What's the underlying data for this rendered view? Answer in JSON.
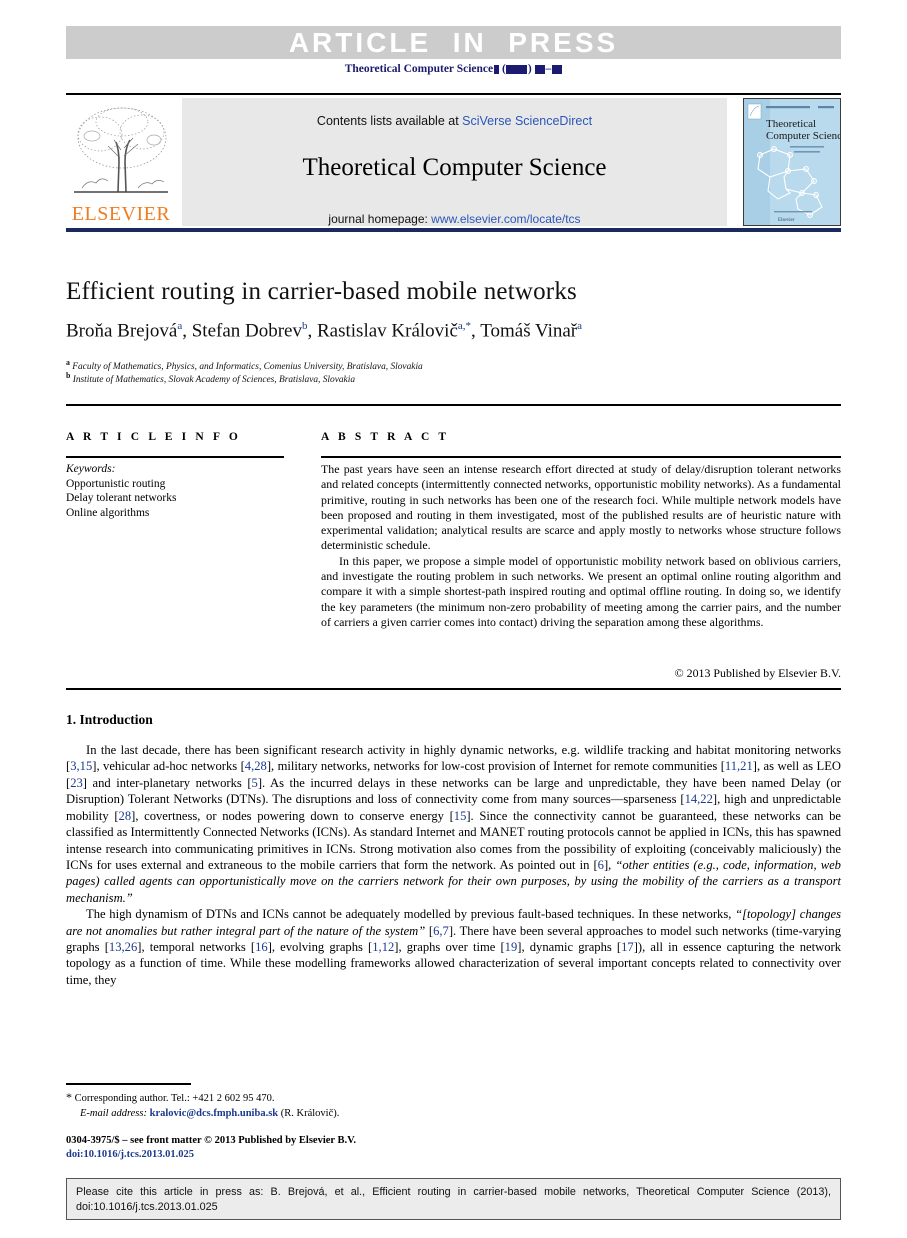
{
  "banner": {
    "label": "ARTICLE  IN  PRESS",
    "background_color": "#cccccc",
    "text_color": "#ffffff"
  },
  "journal_running_head": {
    "name": "Theoretical Computer Science",
    "volume_placeholder": "■",
    "year_placeholder": "(■■■■)",
    "pages_placeholder": "■■■–■■■",
    "color": "#1b1b6f"
  },
  "masthead": {
    "publisher_name": "ELSEVIER",
    "publisher_color": "#ef7d22",
    "publisher_logo_icon": "elsevier-tree-icon",
    "contents_prefix": "Contents lists available at",
    "contents_link": "SciVerse ScienceDirect",
    "journal_title": "Theoretical Computer Science",
    "homepage_prefix": "journal homepage:",
    "homepage_link": "www.elsevier.com/locate/tcs",
    "link_color": "#2a56b8",
    "cover_title_line1": "Theoretical",
    "cover_title_line2": "Computer Science",
    "cover_subtitle": "",
    "cover_background_color": "#b9d9ec"
  },
  "article": {
    "title": "Efficient routing in carrier-based mobile networks",
    "authors": [
      {
        "name": "Broňa Brejová",
        "marks": "a"
      },
      {
        "name": "Stefan Dobrev",
        "marks": "b"
      },
      {
        "name": "Rastislav Královič",
        "marks": "a,*"
      },
      {
        "name": "Tomáš Vinař",
        "marks": "a"
      }
    ],
    "affiliations": [
      {
        "mark": "a",
        "text": "Faculty of Mathematics, Physics, and Informatics, Comenius University, Bratislava, Slovakia"
      },
      {
        "mark": "b",
        "text": "Institute of Mathematics, Slovak Academy of Sciences, Bratislava, Slovakia"
      }
    ]
  },
  "article_info": {
    "heading": "A R T I C L E  I N F O",
    "keywords_label": "Keywords:",
    "keywords": [
      "Opportunistic routing",
      "Delay tolerant networks",
      "Online algorithms"
    ]
  },
  "abstract": {
    "heading": "A B S T R A C T",
    "paragraph_1": "The past years have seen an intense research effort directed at study of delay/disruption tolerant networks and related concepts (intermittently connected networks, opportunistic mobility networks). As a fundamental primitive, routing in such networks has been one of the research foci. While multiple network models have been proposed and routing in them investigated, most of the published results are of heuristic nature with experimental validation; analytical results are scarce and apply mostly to networks whose structure follows deterministic schedule.",
    "paragraph_2": "In this paper, we propose a simple model of opportunistic mobility network based on oblivious carriers, and investigate the routing problem in such networks. We present an optimal online routing algorithm and compare it with a simple shortest-path inspired routing and optimal offline routing. In doing so, we identify the key parameters (the minimum non-zero probability of meeting among the carrier pairs, and the number of carriers a given carrier comes into contact) driving the separation among these algorithms.",
    "copyright": "© 2013 Published by Elsevier B.V."
  },
  "sections": {
    "intro_heading": "1. Introduction",
    "intro_p1_parts": {
      "t1": "In the last decade, there has been significant research activity in highly dynamic networks, e.g. wildlife tracking and habitat monitoring networks [",
      "c1": "3,15",
      "t2": "], vehicular ad-hoc networks [",
      "c2": "4,28",
      "t3": "], military networks, networks for low-cost provision of Internet for remote communities [",
      "c3": "11,21",
      "t4": "], as well as LEO [",
      "c4": "23",
      "t5": "] and inter-planetary networks [",
      "c5": "5",
      "t6": "]. As the incurred delays in these networks can be large and unpredictable, they have been named Delay (or Disruption) Tolerant Networks (DTNs). The disruptions and loss of connectivity come from many sources—sparseness [",
      "c6": "14,22",
      "t7": "], high and unpredictable mobility [",
      "c7": "28",
      "t8": "], covertness, or nodes powering down to conserve energy [",
      "c8": "15",
      "t9": "]. Since the connectivity cannot be guaranteed, these networks can be classified as Intermittently Connected Networks (ICNs). As standard Internet and MANET routing protocols cannot be applied in ICNs, this has spawned intense research into communicating primitives in ICNs. Strong motivation also comes from the possibility of exploiting (conceivably maliciously) the ICNs for uses external and extraneous to the mobile carriers that form the network. As pointed out in [",
      "c9": "6",
      "t10": "], ",
      "quote": "“other entities (e.g., code, information, web pages) called agents can opportunistically move on the carriers network for their own purposes, by using the mobility of the carriers as a transport mechanism.”"
    },
    "intro_p2_parts": {
      "t1": "The high dynamism of DTNs and ICNs cannot be adequately modelled by previous fault-based techniques. In these networks, ",
      "quote": "“[topology] changes are not anomalies but rather integral part of the nature of the system”",
      "t2": " [",
      "c1": "6,7",
      "t3": "]. There have been several approaches to model such networks (time-varying graphs [",
      "c2": "13,26",
      "t4": "], temporal networks [",
      "c3": "16",
      "t5": "], evolving graphs [",
      "c4": "1,12",
      "t6": "], graphs over time [",
      "c5": "19",
      "t7": "], dynamic graphs [",
      "c6": "17",
      "t8": "]), all in essence capturing the network topology as a function of time. While these modelling frameworks allowed characterization of several important concepts related to connectivity over time, they"
    }
  },
  "footnotes": {
    "star": "*",
    "corresponding": "Corresponding author. Tel.: +421 2 602 95 470.",
    "email_label": "E-mail address:",
    "email": "kralovic@dcs.fmph.uniba.sk",
    "email_owner": "(R. Královič)."
  },
  "footer": {
    "issn_line": "0304-3975/$ – see front matter © 2013 Published by Elsevier B.V.",
    "doi_line": "doi:10.1016/j.tcs.2013.01.025",
    "cite_notice": "Please cite this article in press as: B. Brejová, et al., Efficient routing in carrier-based mobile networks, Theoretical Computer Science (2013), doi:10.1016/j.tcs.2013.01.025"
  }
}
